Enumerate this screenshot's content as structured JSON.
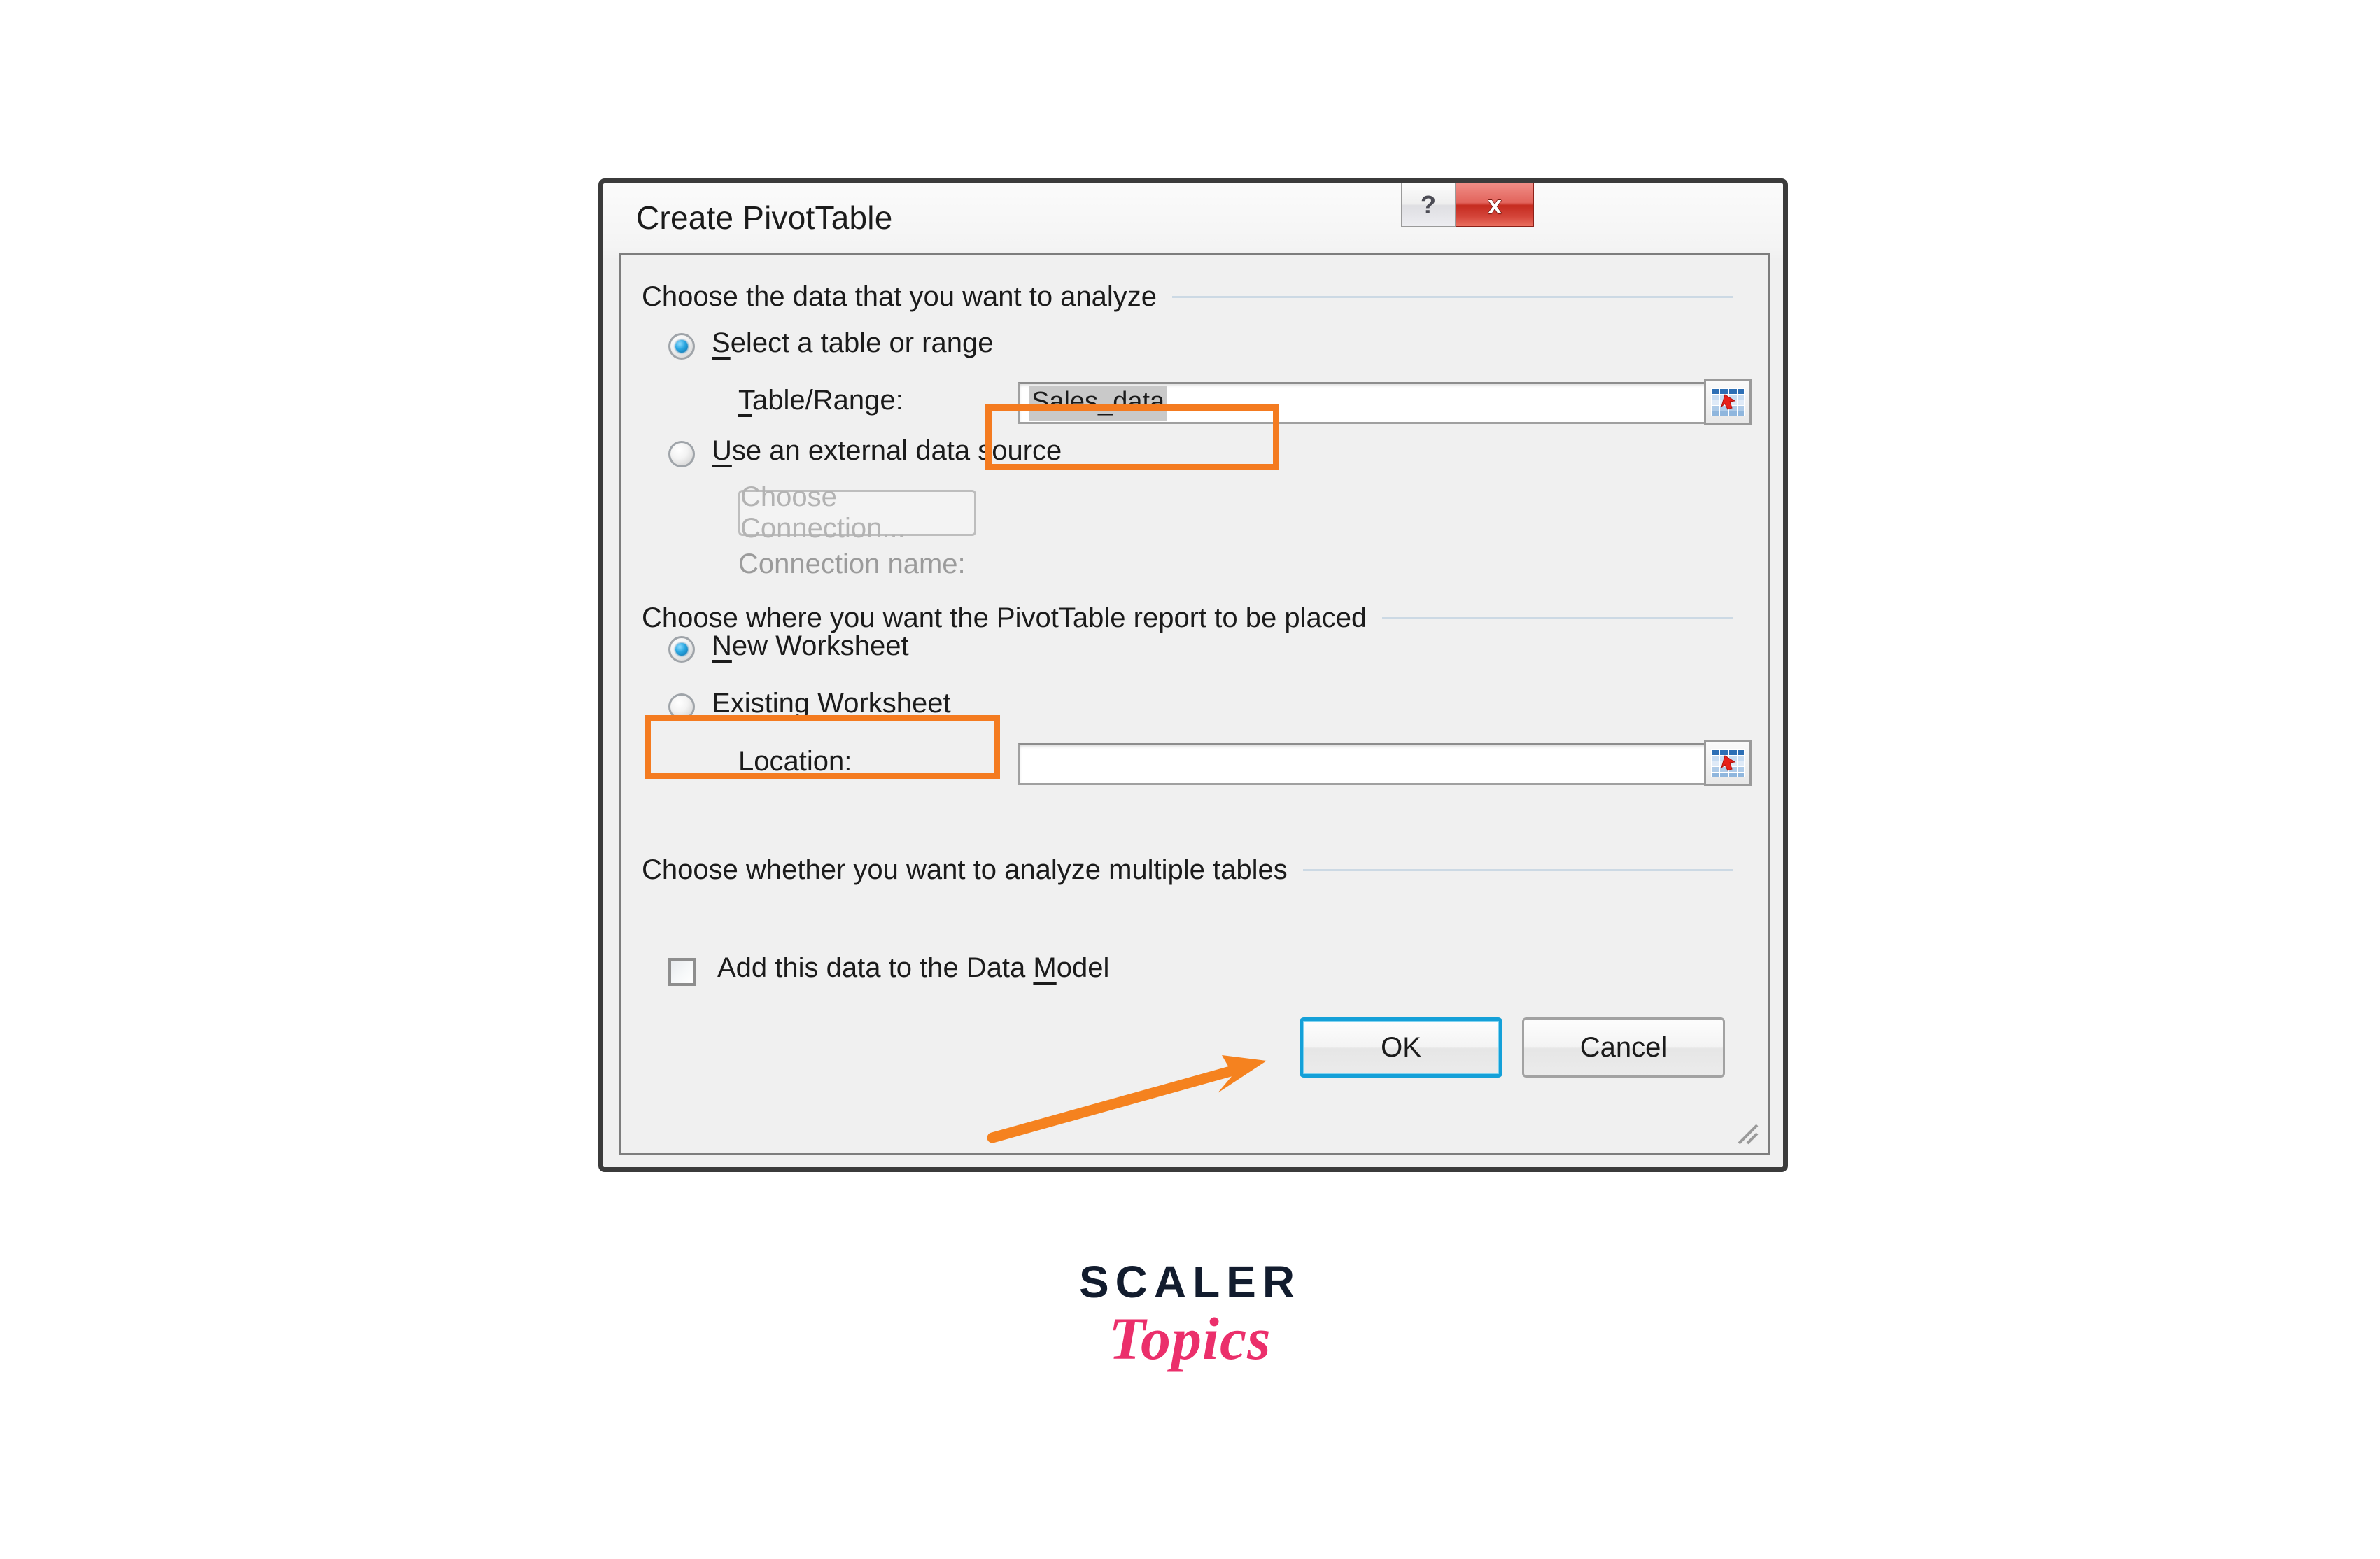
{
  "dialog": {
    "title": "Create PivotTable",
    "titlebar": {
      "help_label": "?",
      "close_label": "x",
      "help_icon": "question-mark-icon",
      "close_icon": "close-x-icon"
    },
    "groups": {
      "data_source": {
        "header": "Choose the data that you want to analyze",
        "option_table_range": {
          "label": "Select a table or range",
          "selected": true
        },
        "table_range_field": {
          "label": "Table/Range:",
          "value": "Sales_data",
          "value_selected": true,
          "picker_icon": "range-picker-icon"
        },
        "option_external": {
          "label": "Use an external data source",
          "selected": false
        },
        "choose_connection_button": {
          "label": "Choose Connection...",
          "disabled": true
        },
        "connection_name_label": {
          "label": "Connection name:",
          "value": "",
          "disabled": true
        }
      },
      "placement": {
        "header": "Choose where you want the PivotTable report to be placed",
        "option_new_worksheet": {
          "label": "New Worksheet",
          "selected": true
        },
        "option_existing_worksheet": {
          "label": "Existing Worksheet",
          "selected": false
        },
        "location_field": {
          "label": "Location:",
          "value": "",
          "picker_icon": "range-picker-icon"
        }
      },
      "multiple_tables": {
        "header": "Choose whether you want to analyze multiple tables",
        "data_model_checkbox": {
          "label": "Add this data to the Data Model",
          "checked": false
        }
      }
    },
    "buttons": {
      "ok": "OK",
      "cancel": "Cancel"
    }
  },
  "annotations": {
    "highlight_color": "#F47B20",
    "focus_color": "#14A0D8",
    "arrow": "orange-arrow-pointing-to-ok"
  },
  "watermark": {
    "line1": "SCALER",
    "line2": "Topics",
    "line1_color": "#121C2E",
    "line2_color": "#EB2F6B"
  }
}
